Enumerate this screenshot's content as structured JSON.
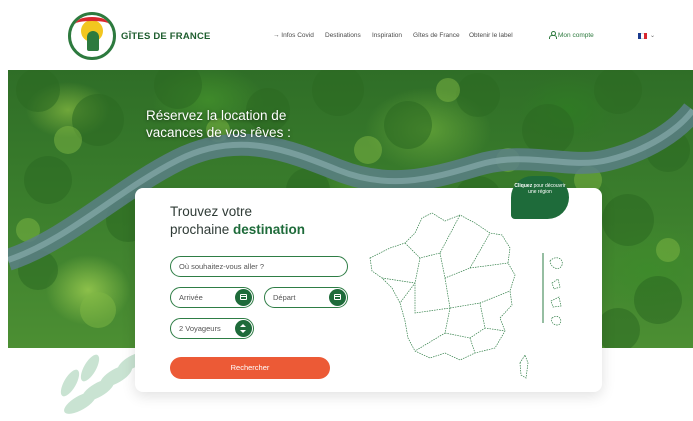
{
  "header": {
    "brand": "GÎTES DE FRANCE",
    "logo_text": "GÎTES DE FRANCE",
    "nav": {
      "covid": "→ Infos Covid",
      "destinations": "Destinations",
      "inspiration": "Inspiration",
      "gites": "Gîtes de France",
      "label": "Obtenir le label"
    },
    "account": "Mon compte",
    "language_icon": "french-flag-icon",
    "colors": {
      "brand_green": "#1f5e2f",
      "flag": [
        "#1b3c8f",
        "#ffffff",
        "#d9272e"
      ]
    }
  },
  "hero": {
    "title": "Réservez la location de vacances de vos rêves :"
  },
  "search_card": {
    "title_line1": "Trouvez votre",
    "title_line2_plain": "prochaine ",
    "title_line2_accent": "destination",
    "where_placeholder": "Où souhaitez-vous aller ?",
    "arrival_placeholder": "Arrivée",
    "departure_placeholder": "Départ",
    "travelers_value": "2 Voyageurs",
    "search_label": "Rechercher",
    "colors": {
      "accent_green": "#1e6b3a",
      "cta_orange": "#ec5a36"
    }
  },
  "map_bubble": {
    "bold": "Cliquez",
    "rest": " pour découvrir une région"
  }
}
